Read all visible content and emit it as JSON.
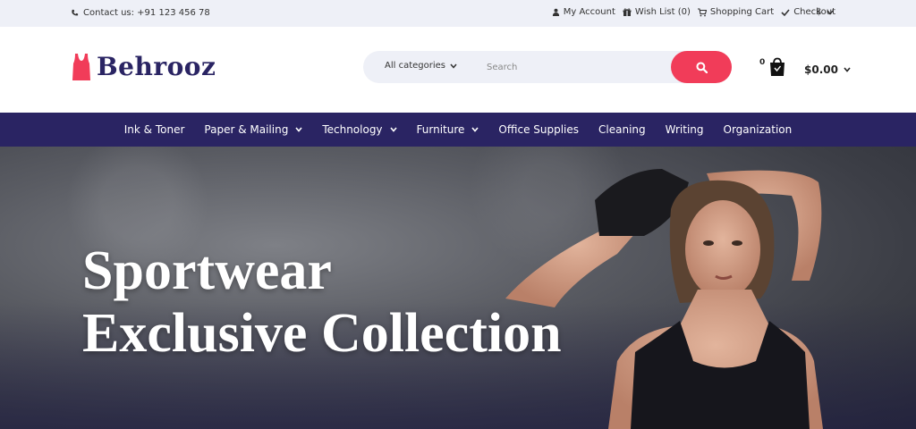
{
  "topbar": {
    "contact": "Contact us: +91 123 456 78",
    "links": [
      {
        "icon": "user-icon",
        "label": "My Account"
      },
      {
        "icon": "gift-icon",
        "label": "Wish List (0)"
      },
      {
        "icon": "cart-icon",
        "label": "Shopping Cart"
      },
      {
        "icon": "check-icon",
        "label": "Checkout"
      }
    ],
    "currency": "$"
  },
  "header": {
    "logo_text": "Behrooz",
    "search": {
      "category": "All categories",
      "placeholder": "Search"
    },
    "cart": {
      "count": "0",
      "total": "$0.00"
    }
  },
  "nav": {
    "items": [
      {
        "label": "Ink & Toner",
        "dropdown": false
      },
      {
        "label": "Paper & Mailing",
        "dropdown": true
      },
      {
        "label": "Technology",
        "dropdown": true
      },
      {
        "label": "Furniture",
        "dropdown": true
      },
      {
        "label": "Office Supplies",
        "dropdown": false
      },
      {
        "label": "Cleaning",
        "dropdown": false
      },
      {
        "label": "Writing",
        "dropdown": false
      },
      {
        "label": "Organization",
        "dropdown": false
      }
    ]
  },
  "hero": {
    "line1": "Sportwear",
    "line2": "Exclusive Collection"
  },
  "colors": {
    "brand_navy": "#2a2463",
    "accent_pink": "#f13c59",
    "topbar_bg": "#eef0f7"
  }
}
